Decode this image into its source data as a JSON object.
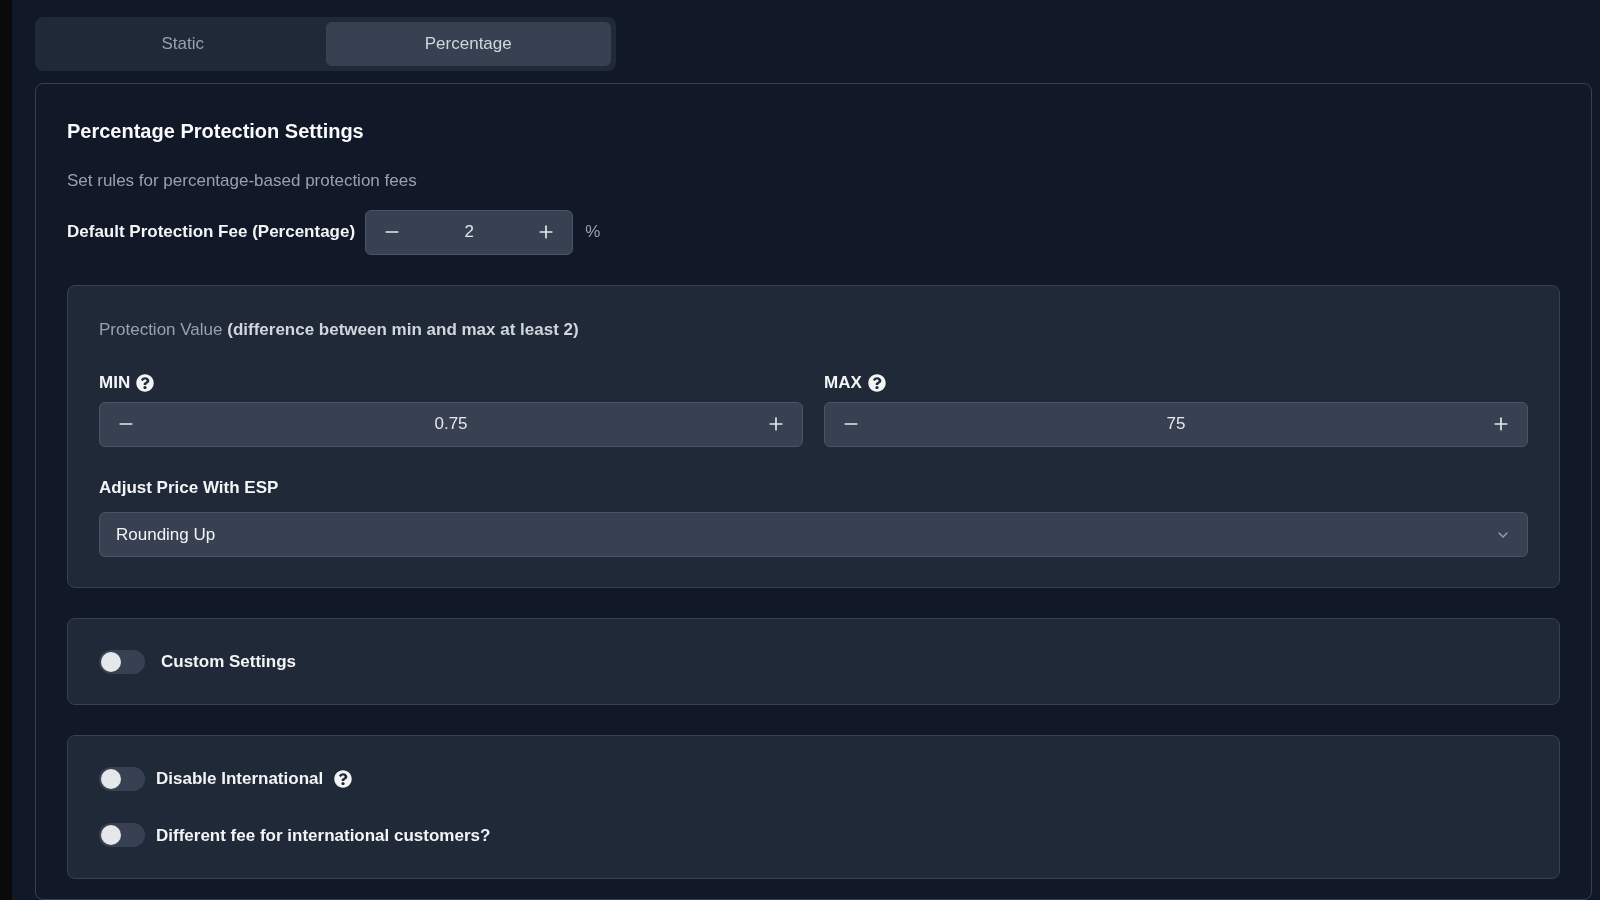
{
  "tabs": [
    {
      "label": "Static",
      "selected": false
    },
    {
      "label": "Percentage",
      "selected": true
    }
  ],
  "settings": {
    "title": "Percentage Protection Settings",
    "description": "Set rules for percentage-based protection fees",
    "default_fee": {
      "label": "Default Protection Fee (Percentage)",
      "value": "2",
      "unit": "%"
    }
  },
  "protection_value": {
    "heading": "Protection Value **(difference between min and max at least 2)**",
    "fields": [
      {
        "label": "MIN",
        "value": "0.75"
      },
      {
        "label": "MAX",
        "value": "75"
      }
    ],
    "adjust_price": {
      "label": "Adjust Price With ESP",
      "value": "Rounding Up"
    }
  },
  "custom_settings": [
    {
      "label": "Custom Settings",
      "on": false,
      "help": false
    }
  ],
  "international": [
    {
      "label": "Disable International",
      "on": false,
      "help": true
    },
    {
      "label": "Different fee for international customers?",
      "on": false,
      "help": false
    }
  ]
}
